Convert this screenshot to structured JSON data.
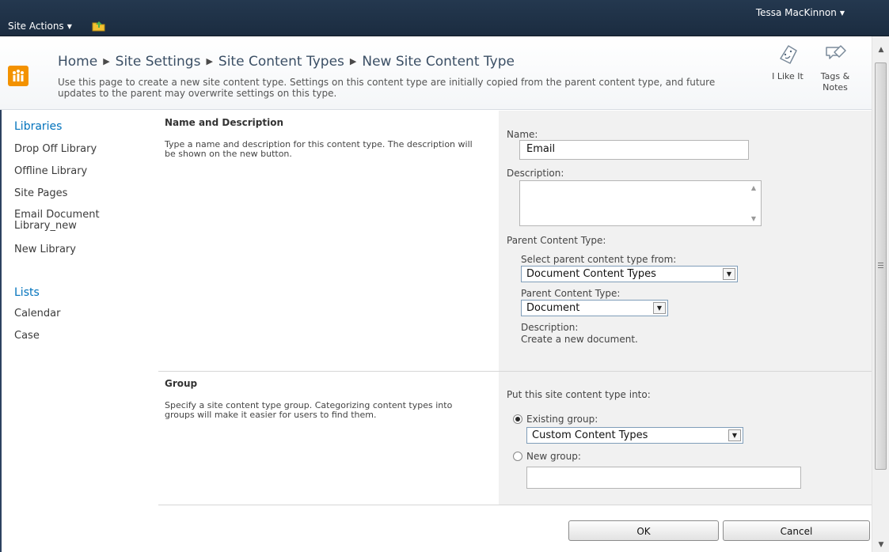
{
  "topbar": {
    "site_actions": "Site Actions",
    "user_name": "Tessa MacKinnon"
  },
  "title": {
    "breadcrumb": [
      "Home",
      "Site Settings",
      "Site Content Types",
      "New Site Content Type"
    ],
    "description": "Use this page to create a new site content type. Settings on this content type are initially copied from the parent content type, and future updates to the parent may overwrite settings on this type.",
    "like_label": "I Like It",
    "tags_label": "Tags & Notes"
  },
  "nav": {
    "libraries_heading": "Libraries",
    "libraries": [
      "Drop Off Library",
      "Offline Library",
      "Site Pages",
      "Email Document Library_new",
      "New Library"
    ],
    "lists_heading": "Lists",
    "lists": [
      "Calendar",
      "Case"
    ]
  },
  "name_section": {
    "title": "Name and Description",
    "text": "Type a name and description for this content type. The description will be shown on the new button.",
    "name_label": "Name:",
    "name_value": "Email",
    "description_label": "Description:",
    "description_value": "",
    "parent_label": "Parent Content Type:",
    "select_from_label": "Select parent content type from:",
    "select_from_value": "Document Content Types",
    "parent_type_label": "Parent Content Type:",
    "parent_type_value": "Document",
    "parent_desc_label": "Description:",
    "parent_desc_value": "Create a new document."
  },
  "group_section": {
    "title": "Group",
    "text": "Specify a site content type group. Categorizing content types into groups will make it easier for users to find them.",
    "put_into_label": "Put this site content type into:",
    "existing_label": "Existing group:",
    "existing_value": "Custom Content Types",
    "new_label": "New group:",
    "new_value": ""
  },
  "buttons": {
    "ok": "OK",
    "cancel": "Cancel"
  },
  "colors": {
    "topbar": "#1f3147",
    "nav_heading": "#0072bc",
    "logo": "#f39200"
  }
}
